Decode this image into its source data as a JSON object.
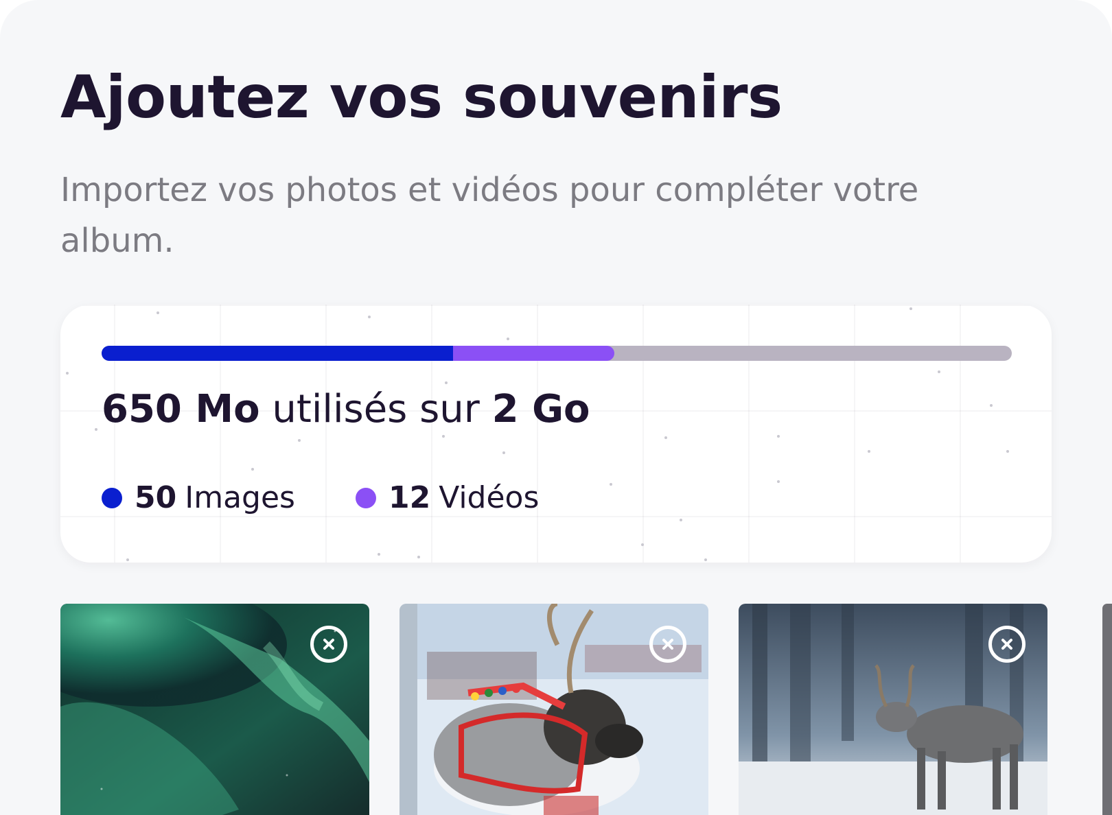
{
  "header": {
    "title": "Ajoutez vos souvenirs",
    "subtitle": "Importez vos photos et vidéos pour compléter votre album."
  },
  "storage": {
    "used_value": "650 Mo",
    "used_text": " utilisés sur ",
    "total_value": "2 Go",
    "progress": [
      {
        "name": "images",
        "fraction": 0.386,
        "color": "#0a1fcf"
      },
      {
        "name": "videos",
        "fraction": 0.177,
        "color": "#8b50f5"
      }
    ],
    "track_color": "#b9b3c1",
    "legend": [
      {
        "count": "50",
        "label": "Images",
        "color": "#0a1fcf"
      },
      {
        "count": "12",
        "label": "Vidéos",
        "color": "#8b50f5"
      }
    ]
  },
  "media": [
    {
      "subject": "aurora-borealis",
      "remove_icon": "close-circle-icon"
    },
    {
      "subject": "reindeer-with-harness",
      "remove_icon": "close-circle-icon"
    },
    {
      "subject": "reindeer-in-snowy-forest",
      "remove_icon": "close-circle-icon"
    }
  ]
}
